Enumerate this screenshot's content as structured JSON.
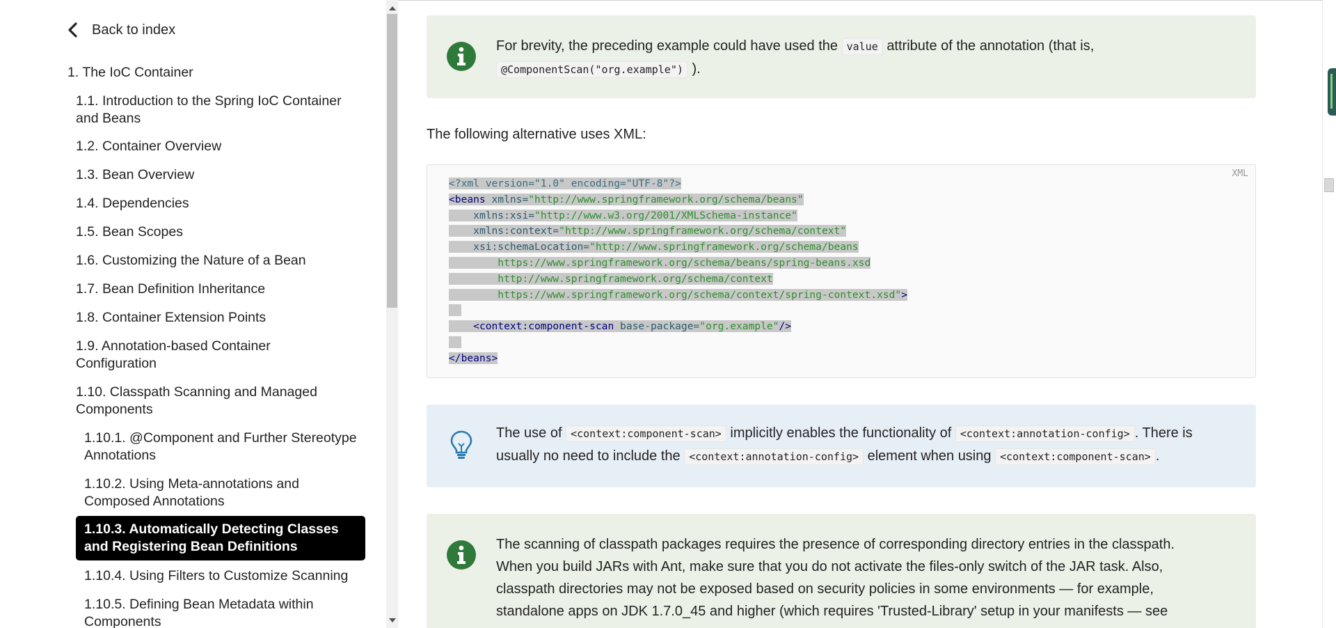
{
  "sidebar": {
    "back_label": "Back to index",
    "items": [
      {
        "label": "1. The IoC Container"
      },
      {
        "label": "1.1. Introduction to the Spring IoC Container and Beans"
      },
      {
        "label": "1.2. Container Overview"
      },
      {
        "label": "1.3. Bean Overview"
      },
      {
        "label": "1.4. Dependencies"
      },
      {
        "label": "1.5. Bean Scopes"
      },
      {
        "label": "1.6. Customizing the Nature of a Bean"
      },
      {
        "label": "1.7. Bean Definition Inheritance"
      },
      {
        "label": "1.8. Container Extension Points"
      },
      {
        "label": "1.9. Annotation-based Container Configuration"
      },
      {
        "label": "1.10. Classpath Scanning and Managed Components"
      },
      {
        "label": "1.10.1. @Component and Further Stereotype Annotations"
      },
      {
        "label": "1.10.2. Using Meta-annotations and Composed Annotations"
      },
      {
        "label": "1.10.3. Automatically Detecting Classes and Registering Bean Definitions"
      },
      {
        "label": "1.10.4. Using Filters to Customize Scanning"
      },
      {
        "label": "1.10.5. Defining Bean Metadata within Components"
      }
    ]
  },
  "note1": {
    "text_a": "For brevity, the preceding example could have used the",
    "code_a": "value",
    "text_b": "attribute of the annotation (that is,",
    "code_b": "@ComponentScan(\"org.example\")",
    "text_c": ")."
  },
  "para": "The following alternative uses XML:",
  "code": {
    "lang": "XML",
    "decl": "<?xml version=\"1.0\" encoding=\"UTF-8\"?>",
    "beans_open": "<beans",
    "xmlns_attr": "xmlns=",
    "xmlns_val": "\"http://www.springframework.org/schema/beans\"",
    "xsi_attr": "xmlns:xsi=",
    "xsi_val": "\"http://www.w3.org/2001/XMLSchema-instance\"",
    "ctx_attr": "xmlns:context=",
    "ctx_val": "\"http://www.springframework.org/schema/context\"",
    "sl_attr": "xsi:schemaLocation=",
    "sl_val1": "\"http://www.springframework.org/schema/beans",
    "sl_val2": "https://www.springframework.org/schema/beans/spring-beans.xsd",
    "sl_val3": "http://www.springframework.org/schema/context",
    "sl_val4": "https://www.springframework.org/schema/context/spring-context.xsd\"",
    "close_bracket": ">",
    "scan_tag": "<context:component-scan",
    "scan_attr": "base-package=",
    "scan_val": "\"org.example\"",
    "scan_end": "/>",
    "beans_close": "</beans>"
  },
  "tip": {
    "text_a": "The use of",
    "code_a": "<context:component-scan>",
    "text_b": "implicitly enables the functionality of",
    "code_b": "<context:annotation-config>",
    "text_c": ". There is usually no need to include the",
    "code_c": "<context:annotation-config>",
    "text_d": "element when using",
    "code_d": "<context:component-scan>",
    "text_e": "."
  },
  "note2": {
    "line1": "The scanning of classpath packages requires the presence of corresponding directory entries in the classpath.",
    "line2": "When you build JARs with Ant, make sure that you do not activate the files-only switch of the JAR task. Also,",
    "line3": "classpath directories may not be exposed based on security policies in some environments — for example,",
    "line4": "standalone apps on JDK 1.7.0_45 and higher (which requires 'Trusted-Library' setup in your manifests — see"
  }
}
